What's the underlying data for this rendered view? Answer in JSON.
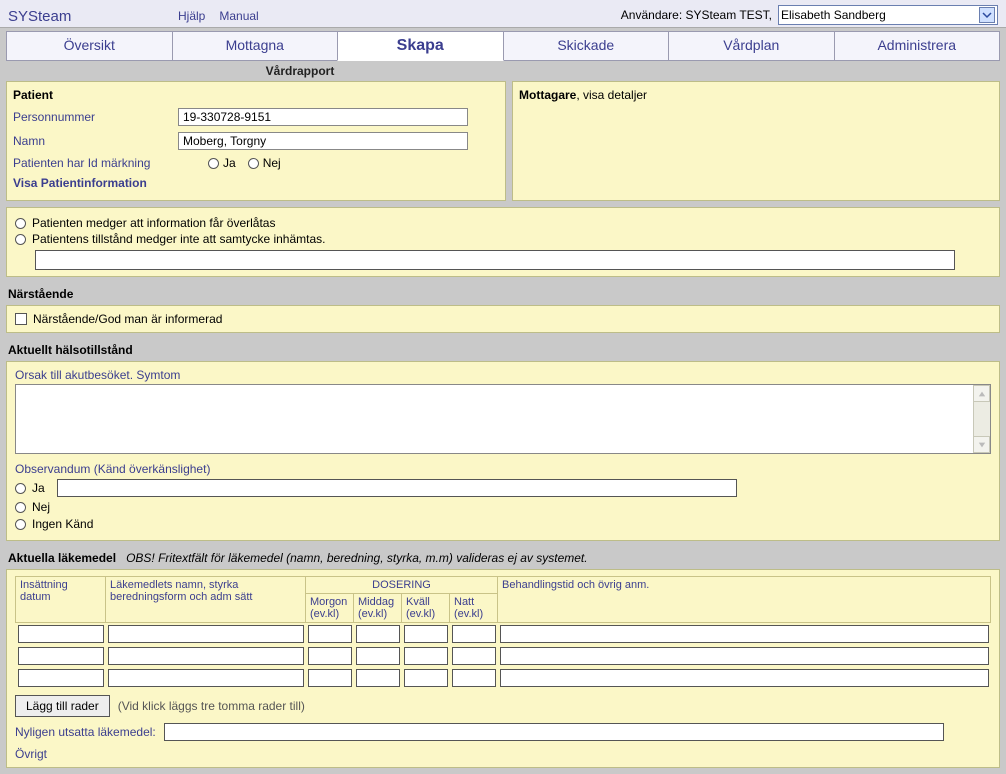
{
  "top": {
    "brand": "SYSteam",
    "links": [
      "Hjälp",
      "Manual"
    ],
    "user_label": "Användare: SYSteam TEST,",
    "select_user": "Elisabeth Sandberg"
  },
  "tabs": [
    "Översikt",
    "Mottagna",
    "Skapa",
    "Skickade",
    "Vårdplan",
    "Administrera"
  ],
  "subheader": "Vårdrapport",
  "patient": {
    "title": "Patient",
    "pn_label": "Personnummer",
    "pn_value": "19-330728-9151",
    "name_label": "Namn",
    "name_value": "Moberg, Torgny",
    "idmark_label": "Patienten har Id märkning",
    "idmark_yes": "Ja",
    "idmark_no": "Nej",
    "show_link": "Visa Patientinformation"
  },
  "recipient": {
    "title": "Mottagare",
    "suffix": ", visa detaljer"
  },
  "consent": {
    "opt1": "Patienten medger att information får överlåtas",
    "opt2": "Patientens tillstånd medger inte att samtycke inhämtas."
  },
  "relative": {
    "title": "Närstående",
    "checkbox": "Närstående/God man är informerad"
  },
  "health": {
    "title": "Aktuellt hälsotillstånd",
    "cause": "Orsak till akutbesöket. Symtom",
    "obs": "Observandum (Känd överkänslighet)",
    "ja": "Ja",
    "nej": "Nej",
    "ingen": "Ingen Känd"
  },
  "meds": {
    "title": "Aktuella läkemedel",
    "hint": "OBS! Fritextfält för läkemedel (namn, beredning, styrka, m.m) valideras ej av systemet.",
    "cols": {
      "c1": "Insättning datum",
      "c2": "Läkemedlets namn, styrka beredningsform och adm sätt",
      "dosering": "DOSERING",
      "d1": "Morgon (ev.kl)",
      "d2": "Middag (ev.kl)",
      "d3": "Kväll (ev.kl)",
      "d4": "Natt (ev.kl)",
      "c3": "Behandlingstid och övrig anm."
    },
    "add_btn": "Lägg till rader",
    "add_hint": "(Vid klick läggs tre tomma rader till)",
    "recent_label": "Nyligen utsatta läkemedel:",
    "other_label": "Övrigt"
  }
}
